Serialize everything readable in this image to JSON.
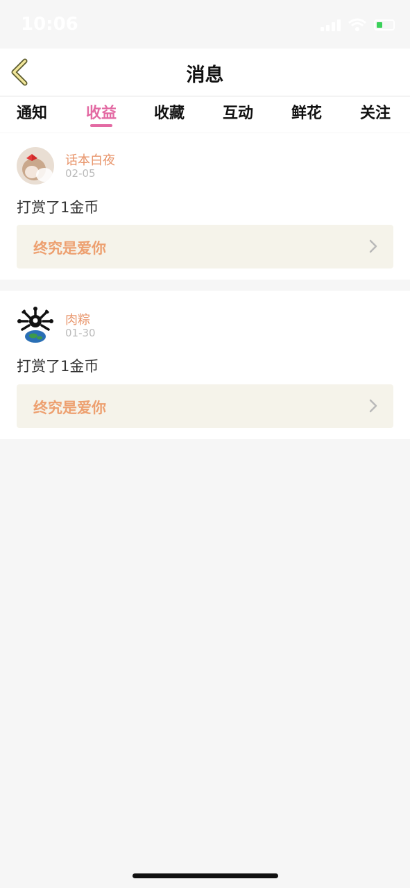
{
  "status": {
    "time": "10:06"
  },
  "header": {
    "title": "消息"
  },
  "tabs": [
    {
      "label": "通知"
    },
    {
      "label": "收益"
    },
    {
      "label": "收藏"
    },
    {
      "label": "互动"
    },
    {
      "label": "鲜花"
    },
    {
      "label": "关注"
    }
  ],
  "active_tab": "收益",
  "messages": [
    {
      "username": "话本白夜",
      "date": "02-05",
      "text": "打赏了1金币",
      "work_title": "终究是爱你"
    },
    {
      "username": "肉粽",
      "date": "01-30",
      "text": "打赏了1金币",
      "work_title": "终究是爱你"
    }
  ],
  "colors": {
    "accent": "#e36aa3",
    "username": "#e8956b",
    "work_title": "#eda070",
    "work_bg": "#f5f3ea",
    "page_bg": "#f6f6f6"
  }
}
